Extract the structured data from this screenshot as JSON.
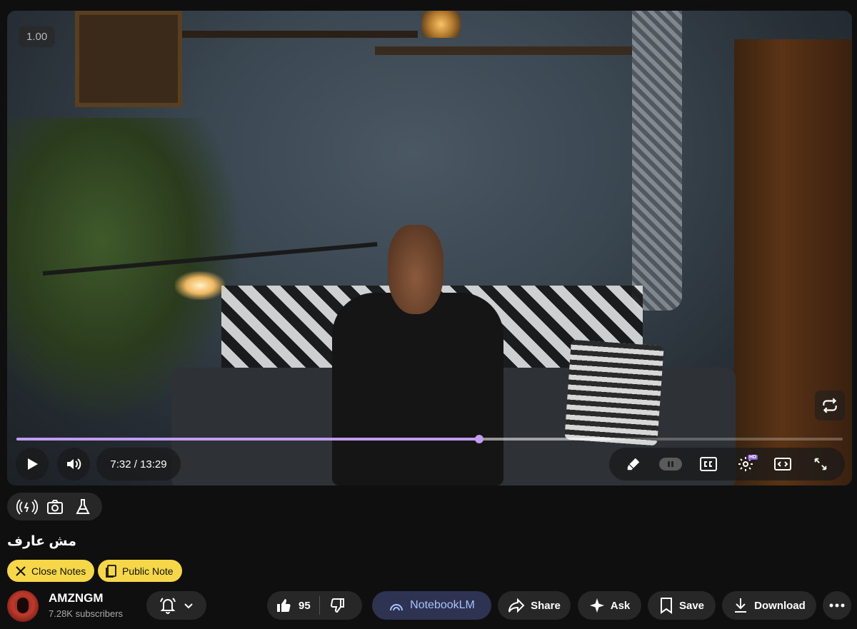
{
  "player": {
    "speed": "1.00",
    "time": {
      "current": "7:32",
      "duration": "13:29",
      "separator": "/"
    },
    "progress": {
      "played_fraction": 0.56,
      "buffered_fraction": 0.72
    },
    "accent_color": "#c29bf2",
    "badges": {
      "hd": "HD"
    }
  },
  "tools": [
    "live-icon",
    "camera-icon",
    "flask-icon"
  ],
  "video": {
    "title": "مش عارف"
  },
  "notes": {
    "close_label": "Close Notes",
    "public_label": "Public Note",
    "color": "#f7d74a"
  },
  "channel": {
    "name": "AMZNGM",
    "subscribers": "7.28K subscribers"
  },
  "actions": {
    "likes": "95",
    "notebook": "NotebookLM",
    "share": "Share",
    "ask": "Ask",
    "save": "Save",
    "download": "Download"
  }
}
